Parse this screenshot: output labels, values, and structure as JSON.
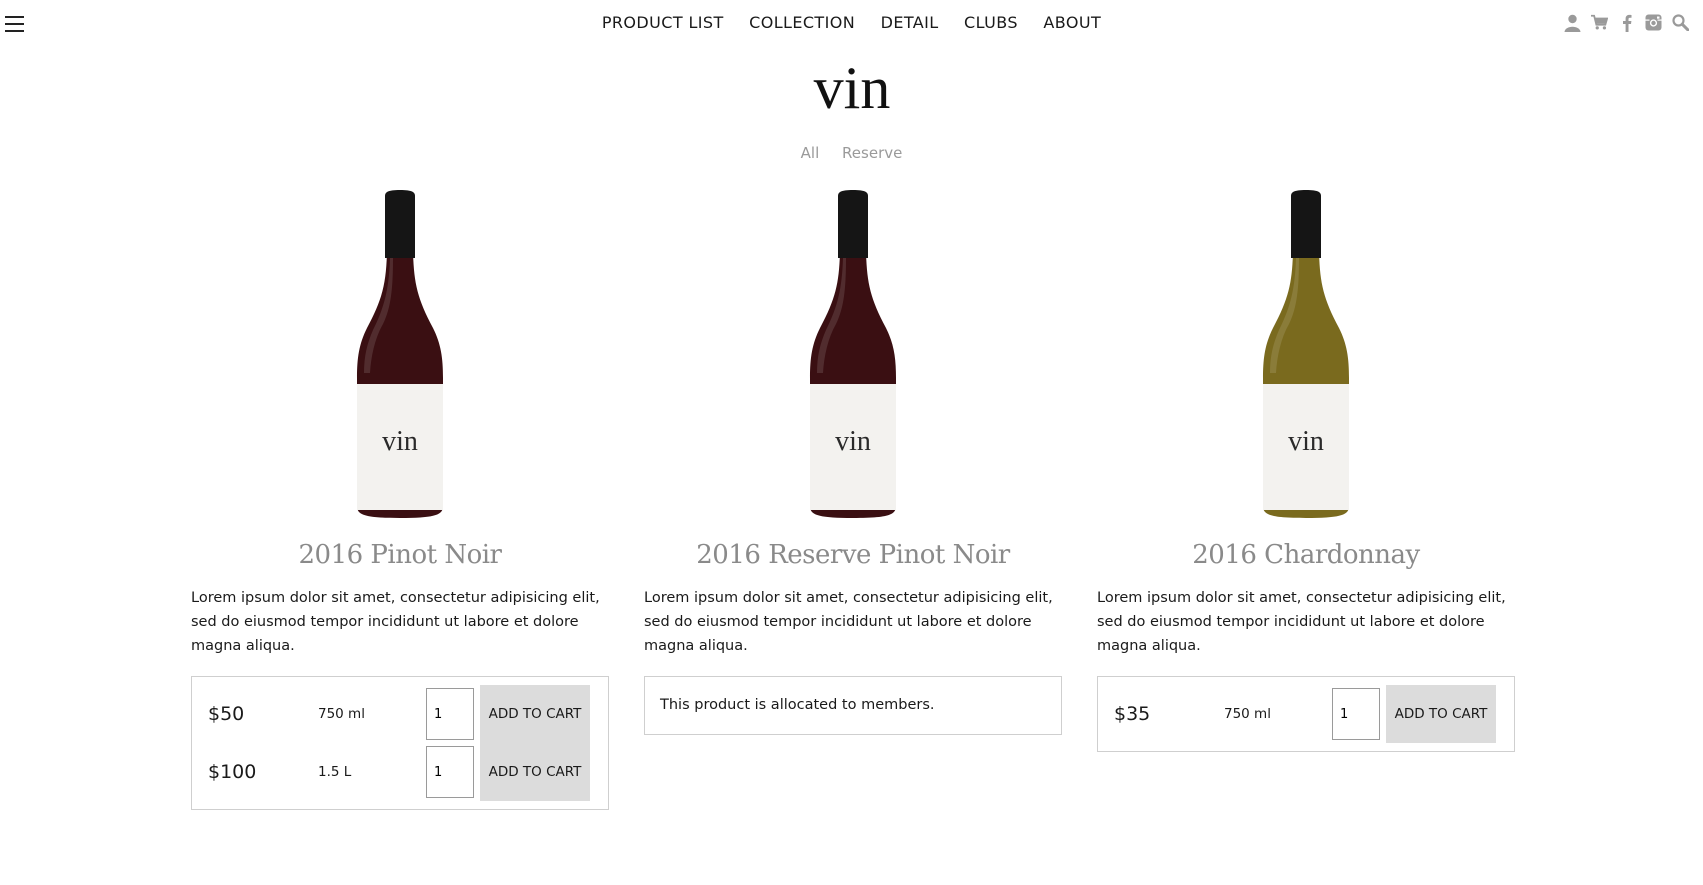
{
  "header": {
    "nav": [
      "PRODUCT LIST",
      "COLLECTION",
      "DETAIL",
      "CLUBS",
      "ABOUT"
    ],
    "icons": [
      "user-icon",
      "cart-icon",
      "facebook-icon",
      "instagram-icon",
      "search-icon"
    ],
    "icon_color": "#9a9a9a",
    "logo_text": "vin"
  },
  "filters": [
    "All",
    "Reserve"
  ],
  "products": [
    {
      "name": "2016 Pinot Noir",
      "wine_color": "#3a0f12",
      "label_text": "vin",
      "description": "Lorem ipsum dolor sit amet, consectetur adipisicing elit, sed do eiusmod tempor incididunt ut labore et dolore magna aliqua.",
      "options": [
        {
          "price": "$50",
          "size": "750 ml",
          "qty": "1",
          "button": "ADD TO CART"
        },
        {
          "price": "$100",
          "size": "1.5 L",
          "qty": "1",
          "button": "ADD TO CART"
        }
      ]
    },
    {
      "name": "2016 Reserve Pinot Noir",
      "wine_color": "#3a0f12",
      "label_text": "vin",
      "description": "Lorem ipsum dolor sit amet, consectetur adipisicing elit, sed do eiusmod tempor incididunt ut labore et dolore magna aliqua.",
      "member_message": "This product is allocated to members."
    },
    {
      "name": "2016 Chardonnay",
      "wine_color": "#7a6a1e",
      "label_text": "vin",
      "description": "Lorem ipsum dolor sit amet, consectetur adipisicing elit, sed do eiusmod tempor incididunt ut labore et dolore magna aliqua.",
      "options": [
        {
          "price": "$35",
          "size": "750 ml",
          "qty": "1",
          "button": "ADD TO CART"
        }
      ]
    }
  ]
}
